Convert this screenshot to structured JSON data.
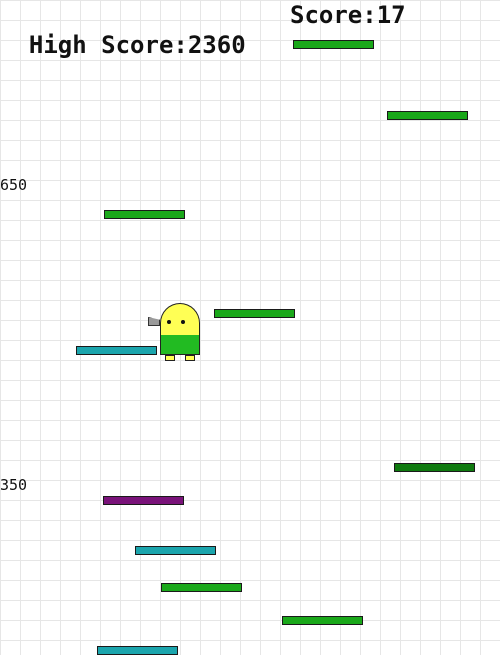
{
  "hud": {
    "high_score_label": "High Score:2360",
    "score_label": "Score:17"
  },
  "height_markers": [
    {
      "label": "650"
    },
    {
      "label": "350"
    }
  ],
  "colors": {
    "green": "#1aa81a",
    "dark_green": "#0f7a0f",
    "teal": "#1ba5ad",
    "purple": "#7a137a",
    "doodler_head": "#ffff55",
    "doodler_body": "#22bb22"
  },
  "platforms": [
    {
      "type": "green"
    },
    {
      "type": "green"
    },
    {
      "type": "green"
    },
    {
      "type": "green"
    },
    {
      "type": "teal"
    },
    {
      "type": "dark_green"
    },
    {
      "type": "purple"
    },
    {
      "type": "teal"
    },
    {
      "type": "green"
    },
    {
      "type": "green"
    },
    {
      "type": "teal"
    }
  ],
  "player": {
    "name": "doodler",
    "weapon": "gun-icon"
  }
}
